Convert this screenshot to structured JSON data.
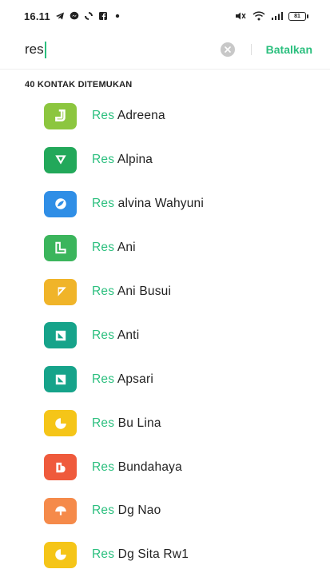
{
  "status_bar": {
    "time": "16.11",
    "battery": "81",
    "left_icons": [
      "telegram-icon",
      "messenger-icon",
      "sync-icon",
      "facebook-icon",
      "dot-icon"
    ],
    "right_icons": [
      "mute-icon",
      "wifi-icon",
      "signal-icon",
      "battery-icon"
    ]
  },
  "search": {
    "query": "res",
    "cancel_label": "Batalkan"
  },
  "result_count_label": "40 KONTAK DITEMUKAN",
  "accent_color": "#2bbf7e",
  "contacts": [
    {
      "prefix": "Res",
      "rest": " Adreena",
      "color": "#8cc63f",
      "icon": "j-shape-icon"
    },
    {
      "prefix": "Res",
      "rest": " Alpina",
      "color": "#22a85a",
      "icon": "triangle-down-icon"
    },
    {
      "prefix": "Res",
      "rest": " alvina Wahyuni",
      "color": "#2f8ee6",
      "icon": "leaf-circle-icon"
    },
    {
      "prefix": "Res",
      "rest": " Ani",
      "color": "#3bb55c",
      "icon": "l-shape-icon"
    },
    {
      "prefix": "Res",
      "rest": " Ani Busui",
      "color": "#f0b429",
      "icon": "flag-triangle-icon"
    },
    {
      "prefix": "Res",
      "rest": " Anti",
      "color": "#16a38a",
      "icon": "diagonal-square-icon"
    },
    {
      "prefix": "Res",
      "rest": " Apsari",
      "color": "#16a38a",
      "icon": "diagonal-square-icon"
    },
    {
      "prefix": "Res",
      "rest": " Bu Lina",
      "color": "#f5c518",
      "icon": "pie-chart-icon"
    },
    {
      "prefix": "Res",
      "rest": " Bundahaya",
      "color": "#ef5a3c",
      "icon": "b-block-icon"
    },
    {
      "prefix": "Res",
      "rest": " Dg Nao",
      "color": "#f58a4a",
      "icon": "mushroom-icon"
    },
    {
      "prefix": "Res",
      "rest": " Dg Sita Rw1",
      "color": "#f5c518",
      "icon": "pie-chart-icon"
    }
  ]
}
